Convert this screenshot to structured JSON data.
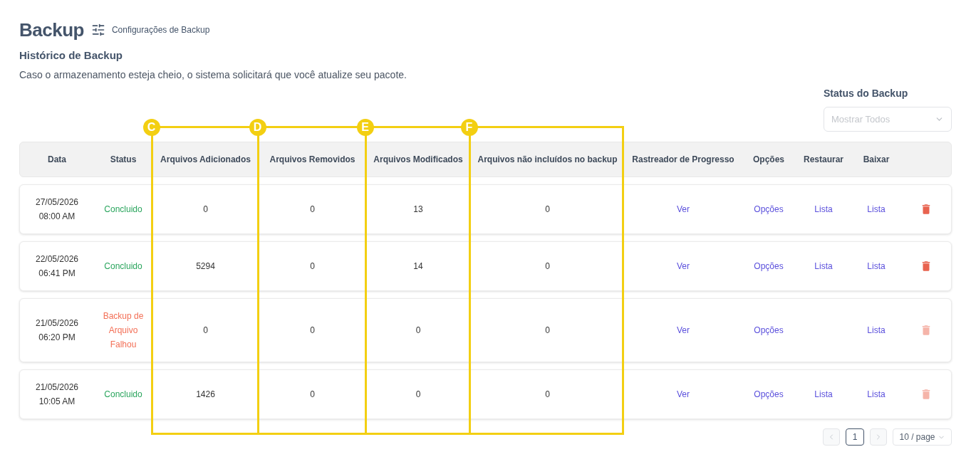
{
  "page": {
    "title": "Backup",
    "settings_link": "Configurações de Backup"
  },
  "section": {
    "title": "Histórico de Backup",
    "description": "Caso o armazenamento esteja cheio, o sistema solicitará que você atualize seu pacote."
  },
  "filter": {
    "label": "Status do Backup",
    "placeholder": "Mostrar Todos"
  },
  "table": {
    "columns": [
      "Data",
      "Status",
      "Arquivos Adicionados",
      "Arquivos Removidos",
      "Arquivos Modificados",
      "Arquivos não incluídos no backup",
      "Rastreador de Progresso",
      "Opções",
      "Restaurar",
      "Baixar"
    ],
    "rows": [
      {
        "date": "27/05/2026",
        "time": "08:00 AM",
        "status": {
          "text": "Concluido",
          "kind": "success"
        },
        "added": "0",
        "removed": "0",
        "modified": "13",
        "excluded": "0",
        "progress": "Ver",
        "options": "Opções",
        "restore": "Lista",
        "download": "Lista",
        "delete_disabled": false
      },
      {
        "date": "22/05/2026",
        "time": "06:41 PM",
        "status": {
          "text": "Concluido",
          "kind": "success"
        },
        "added": "5294",
        "removed": "0",
        "modified": "14",
        "excluded": "0",
        "progress": "Ver",
        "options": "Opções",
        "restore": "Lista",
        "download": "Lista",
        "delete_disabled": false
      },
      {
        "date": "21/05/2026",
        "time": "06:20 PM",
        "status": {
          "text": "Backup de Arquivo Falhou",
          "kind": "failed"
        },
        "added": "0",
        "removed": "0",
        "modified": "0",
        "excluded": "0",
        "progress": "Ver",
        "options": "Opções",
        "download": "Lista",
        "delete_disabled": true
      },
      {
        "date": "21/05/2026",
        "time": "10:05 AM",
        "status": {
          "text": "Concluido",
          "kind": "success"
        },
        "added": "1426",
        "removed": "0",
        "modified": "0",
        "excluded": "0",
        "progress": "Ver",
        "options": "Opções",
        "restore": "Lista",
        "download": "Lista",
        "delete_disabled": true
      }
    ]
  },
  "annotations": [
    {
      "label": "C"
    },
    {
      "label": "D"
    },
    {
      "label": "E"
    },
    {
      "label": "F"
    }
  ],
  "pagination": {
    "prev": {
      "disabled": true
    },
    "pages": [
      {
        "label": "1",
        "selected": true
      }
    ],
    "next": {
      "disabled": true
    },
    "page_size": "10 / page"
  }
}
